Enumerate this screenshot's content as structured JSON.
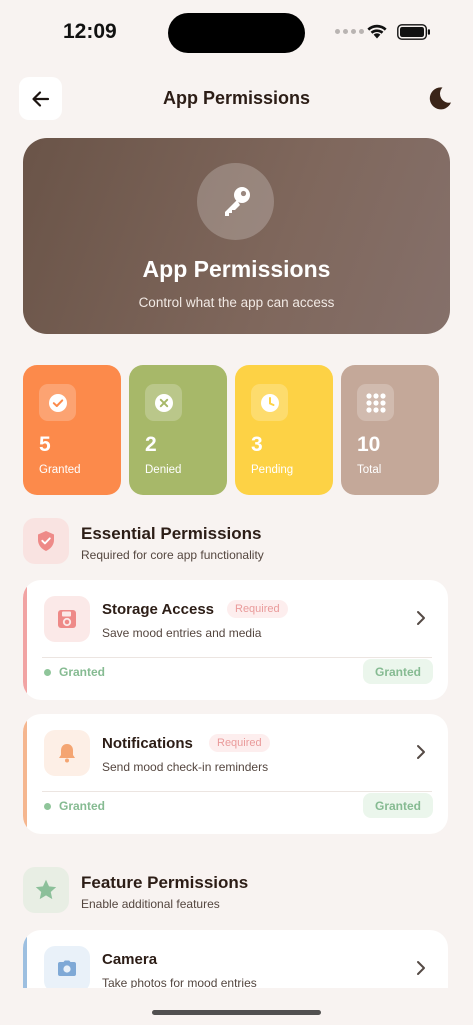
{
  "status_bar": {
    "time": "12:09"
  },
  "header": {
    "title": "App Permissions"
  },
  "hero": {
    "title": "App Permissions",
    "subtitle": "Control what the app can access"
  },
  "stats": [
    {
      "value": "5",
      "label": "Granted",
      "icon": "check-icon",
      "color": "#fc8a4b"
    },
    {
      "value": "2",
      "label": "Denied",
      "icon": "x-icon",
      "color": "#a7b869"
    },
    {
      "value": "3",
      "label": "Pending",
      "icon": "clock-icon",
      "color": "#fdd245"
    },
    {
      "value": "10",
      "label": "Total",
      "icon": "grid-icon",
      "color": "#c4a899"
    }
  ],
  "sections": {
    "essential": {
      "title": "Essential Permissions",
      "subtitle": "Required for core app functionality",
      "icon": "shield-icon",
      "items": [
        {
          "name": "Storage Access",
          "badge": "Required",
          "description": "Save mood entries and media",
          "status": "Granted",
          "status_pill": "Granted",
          "icon": "floppy-icon",
          "accent": "#f1a3a3"
        },
        {
          "name": "Notifications",
          "badge": "Required",
          "description": "Send mood check-in reminders",
          "status": "Granted",
          "status_pill": "Granted",
          "icon": "bell-icon",
          "accent": "#f5b68f"
        }
      ]
    },
    "feature": {
      "title": "Feature Permissions",
      "subtitle": "Enable additional features",
      "icon": "star-icon",
      "items": [
        {
          "name": "Camera",
          "description": "Take photos for mood entries",
          "icon": "camera-icon",
          "accent": "#9dbfe0"
        }
      ]
    }
  },
  "colors": {
    "background": "#f8f3f1",
    "hero_start": "#6a5448",
    "granted_green": "#86bb92",
    "required_red": "#e99a9a"
  }
}
